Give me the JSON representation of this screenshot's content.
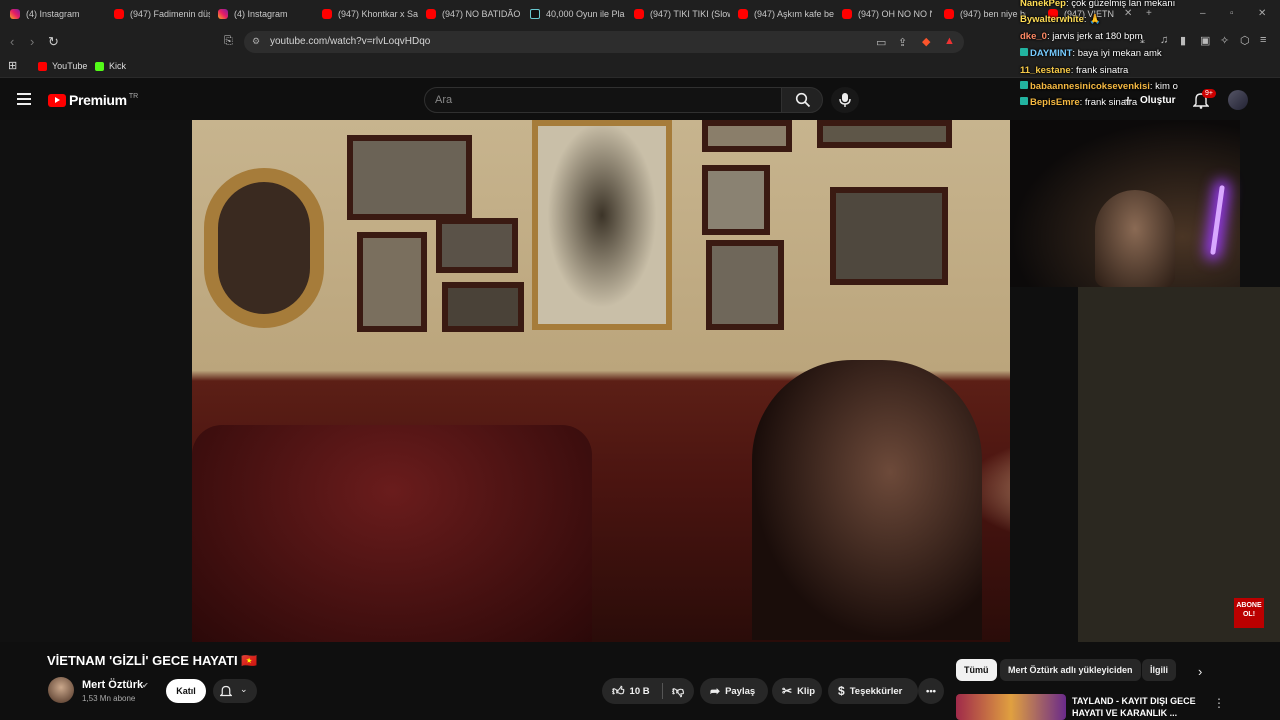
{
  "browser": {
    "tabs": [
      {
        "label": "(4) Instagram",
        "icon": "instagram-icon"
      },
      {
        "label": "(947) Fadimenin düş",
        "icon": "youtube-icon"
      },
      {
        "label": "(4) Instagram",
        "icon": "instagram-icon"
      },
      {
        "label": "(947) Khontkar x Sa",
        "icon": "youtube-icon"
      },
      {
        "label": "(947) NO BATIDÃO",
        "icon": "youtube-icon"
      },
      {
        "label": "40,000 Oyun ile Pla",
        "icon": "tiktok-icon"
      },
      {
        "label": "(947) TIKI TIKI (Slow",
        "icon": "youtube-icon"
      },
      {
        "label": "(947) Aşkım kafe be",
        "icon": "youtube-icon"
      },
      {
        "label": "(947) OH NO NO N",
        "icon": "youtube-icon"
      },
      {
        "label": "(947) ben niye bat",
        "icon": "youtube-icon"
      },
      {
        "label": "(947) VIETN",
        "icon": "youtube-icon"
      }
    ],
    "url": "youtube.com/watch?v=rlvLoqvHDqo",
    "bookmarks": [
      {
        "label": "YouTube",
        "color": "#ff0000"
      },
      {
        "label": "Kick",
        "color": "#53fc18"
      }
    ]
  },
  "youtube": {
    "logo_text": "Premium",
    "logo_region": "TR",
    "search_placeholder": "Ara",
    "create_label": "Oluştur",
    "notif_badge": "9+",
    "video": {
      "title": "VİETNAM 'GİZLİ' GECE HAYATI 🇻🇳",
      "channel": "Mert Öztürk",
      "subscribers": "1,53 Mn abone",
      "join_label": "Katıl",
      "likes": "10 B",
      "share_label": "Paylaş",
      "clip_label": "Klip",
      "thanks_label": "Teşekkürler",
      "overlay_badge": "ABONE OL!"
    },
    "chips": [
      "Tümü",
      "Mert Öztürk adlı yükleyiciden",
      "İlgili"
    ],
    "recommendation": {
      "title": "TAYLAND - KAYIT DIŞI GECE HAYATI VE KARANLIK ..."
    }
  },
  "chat": [
    {
      "user": "NanekPep",
      "msg": "çok güzelmiş lan mekanı"
    },
    {
      "user": "Bywalterwhite",
      "msg": "🙏"
    },
    {
      "user": "dke_0",
      "msg": "jarvis jerk at 180 bpm"
    },
    {
      "user": "DAYMINT",
      "msg": "baya iyi mekan amk"
    },
    {
      "user": "11_kestane",
      "msg": "frank sinatra"
    },
    {
      "user": "babaannesinicoksevenkisi",
      "msg": "kim o"
    },
    {
      "user": "BepisEmre",
      "msg": "frank sinatra"
    }
  ]
}
